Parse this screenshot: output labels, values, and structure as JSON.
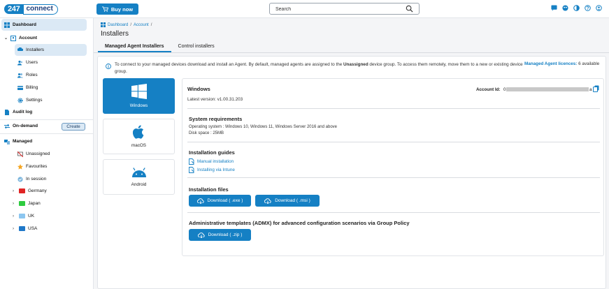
{
  "app": {
    "logo_num": "247",
    "logo_word": "connect",
    "buy_label": "Buy now"
  },
  "search": {
    "placeholder": "Search"
  },
  "sidebar": {
    "dashboard": "Dashboard",
    "account": "Account",
    "installers": "Installers",
    "users": "Users",
    "roles": "Roles",
    "billing": "Billing",
    "settings": "Settings",
    "audit_log": "Audit log",
    "on_demand": "On-demand",
    "create": "Create",
    "managed": "Managed",
    "unassigned": "Unassigned",
    "favourites": "Favourites",
    "in_session": "In session",
    "groups": [
      {
        "label": "Germany",
        "color": "#e02424"
      },
      {
        "label": "Japan",
        "color": "#2ecc40"
      },
      {
        "label": "UK",
        "color": "#8cc6f0"
      },
      {
        "label": "USA",
        "color": "#1f78c8"
      }
    ]
  },
  "breadcrumb": {
    "dashboard": "Dashboard",
    "sep1": "/",
    "account": "Account",
    "sep2": "/"
  },
  "page": {
    "title": "Installers"
  },
  "tabs": {
    "managed": "Managed Agent Installers",
    "control": "Control installers"
  },
  "info": {
    "text_before": "To connect to your managed devices download and install an Agent. By default, managed agents are assigned to the ",
    "bold_word": "Unassigned",
    "text_after": " device group. To access them remotely, move them to a new or existing device group.",
    "licences_label": "Managed Agent licences:",
    "licences_value": "6 available"
  },
  "os_cards": [
    {
      "label": "Windows",
      "icon": "windows-icon",
      "active": true
    },
    {
      "label": "macOS",
      "icon": "apple-icon",
      "active": false
    },
    {
      "label": "Android",
      "icon": "android-icon",
      "active": false
    }
  ],
  "detail": {
    "os_title": "Windows",
    "version": "Latest version: v1.00.31.203",
    "account_label": "Account Id:",
    "account_prefix": "0",
    "account_suffix": "a",
    "requirements_title": "System requirements",
    "requirements_os": "Operating system : Windows 10, Windows 11, Windows Server 2016 and above",
    "requirements_disk": "Disk space : 25MB",
    "guides_title": "Installation guides",
    "guide_manual": "Manual installation",
    "guide_intune": "Installing via Intune",
    "files_title": "Installation files",
    "dl_exe": "Download ( .exe )",
    "dl_msi": "Download ( .msi )",
    "admx_title": "Administrative templates (ADMX) for advanced configuration scenarios via Group Policy",
    "dl_zip": "Download ( .zip )"
  },
  "colors": {
    "accent": "#1580c4",
    "active_bg": "#dbe9f5",
    "main_bg": "#f4f5f7"
  }
}
